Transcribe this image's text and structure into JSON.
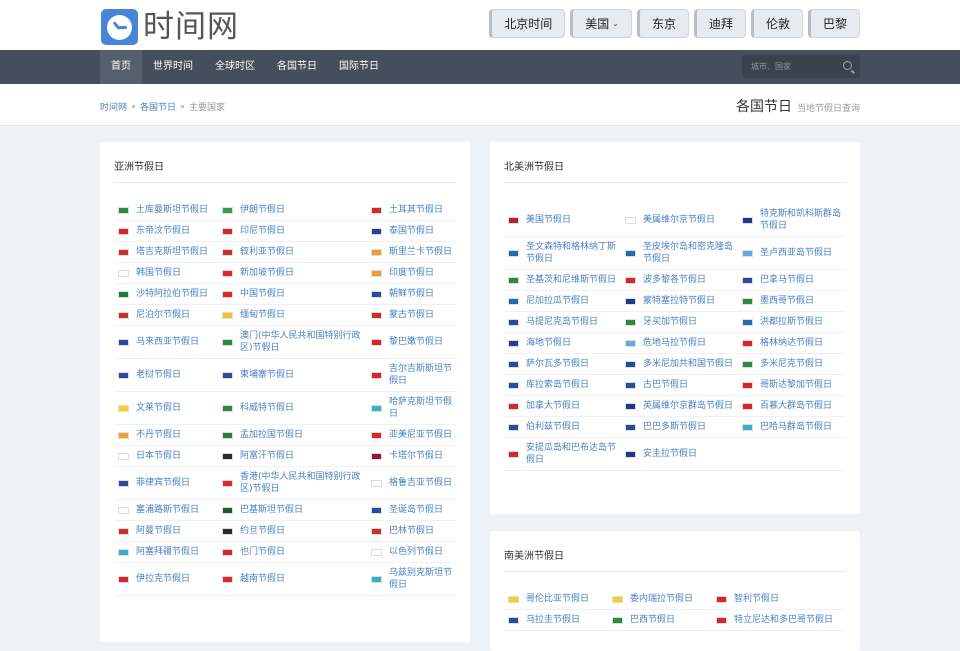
{
  "brand": {
    "logo_text": "时间网"
  },
  "cities": [
    "北京时间",
    "美国",
    "东京",
    "迪拜",
    "伦敦",
    "巴黎"
  ],
  "menu": [
    "首页",
    "世界时间",
    "全球时区",
    "各国节日",
    "国际节日"
  ],
  "search": {
    "placeholder": "城市、国家"
  },
  "breadcrumb": [
    "时间网",
    "各国节日",
    "主要国家"
  ],
  "page": {
    "title": "各国节日",
    "subtitle": "当地节假日查询"
  },
  "asia": {
    "title": "亚洲节假日",
    "rows": [
      [
        {
          "n": "土库曼斯坦节假日",
          "c": "#2b8a3e"
        },
        {
          "n": "伊朗节假日",
          "c": "#3a9a4a"
        },
        {
          "n": "土耳其节假日",
          "c": "#d7262b"
        }
      ],
      [
        {
          "n": "东帝汶节假日",
          "c": "#d6262b"
        },
        {
          "n": "印尼节假日",
          "c": "#d6262b"
        },
        {
          "n": "泰国节假日",
          "c": "#2c3e8f"
        }
      ],
      [
        {
          "n": "塔吉克斯坦节假日",
          "c": "#c9302c"
        },
        {
          "n": "叙利亚节假日",
          "c": "#c9302c"
        },
        {
          "n": "斯里兰卡节假日",
          "c": "#e3a127"
        }
      ],
      [
        {
          "n": "韩国节假日",
          "c": "#ffffff"
        },
        {
          "n": "新加坡节假日",
          "c": "#e2262b"
        },
        {
          "n": "印度节假日",
          "c": "#f29b38"
        }
      ],
      [
        {
          "n": "沙特阿拉伯节假日",
          "c": "#1f7a3a"
        },
        {
          "n": "中国节假日",
          "c": "#e2262b"
        },
        {
          "n": "朝鲜节假日",
          "c": "#2a4aa0"
        }
      ],
      [
        {
          "n": "尼泊尔节假日",
          "c": "#c9302c"
        },
        {
          "n": "缅甸节假日",
          "c": "#f4c02b"
        },
        {
          "n": "蒙古节假日",
          "c": "#c9302c"
        }
      ],
      [
        {
          "n": "马来西亚节假日",
          "c": "#2a4aa0"
        },
        {
          "n": "澳门(中华人民共和国特别行政区)节假日",
          "c": "#2b8a3e"
        },
        {
          "n": "黎巴嫩节假日",
          "c": "#d7262b"
        }
      ],
      [
        {
          "n": "老挝节假日",
          "c": "#2a4aa0"
        },
        {
          "n": "柬埔寨节假日",
          "c": "#2a4aa0"
        },
        {
          "n": "吉尔吉斯斯坦节假日",
          "c": "#d7262b"
        }
      ],
      [
        {
          "n": "文莱节假日",
          "c": "#f4d02b"
        },
        {
          "n": "科威特节假日",
          "c": "#2b8a3e"
        },
        {
          "n": "哈萨克斯坦节假日",
          "c": "#3ab0c8"
        }
      ],
      [
        {
          "n": "不丹节假日",
          "c": "#f29b38"
        },
        {
          "n": "孟加拉国节假日",
          "c": "#2b7a3e"
        },
        {
          "n": "亚美尼亚节假日",
          "c": "#d7262b"
        }
      ],
      [
        {
          "n": "日本节假日",
          "c": "#ffffff"
        },
        {
          "n": "阿富汗节假日",
          "c": "#2b2b2b"
        },
        {
          "n": "卡塔尔节假日",
          "c": "#8a1c3a"
        }
      ],
      [
        {
          "n": "菲律宾节假日",
          "c": "#2a4aa0"
        },
        {
          "n": "香港(中华人民共和国特别行政区)节假日",
          "c": "#e2262b"
        },
        {
          "n": "格鲁吉亚节假日",
          "c": "#ffffff"
        }
      ],
      [
        {
          "n": "塞浦路斯节假日",
          "c": "#ffffff"
        },
        {
          "n": "巴基斯坦节假日",
          "c": "#1f5a2a"
        },
        {
          "n": "圣诞岛节假日",
          "c": "#2a4aa0"
        }
      ],
      [
        {
          "n": "阿曼节假日",
          "c": "#c9302c"
        },
        {
          "n": "约旦节假日",
          "c": "#2b2b2b"
        },
        {
          "n": "巴林节假日",
          "c": "#c9302c"
        }
      ],
      [
        {
          "n": "阿塞拜疆节假日",
          "c": "#3ab0c8"
        },
        {
          "n": "也门节假日",
          "c": "#d7262b"
        },
        {
          "n": "以色列节假日",
          "c": "#ffffff"
        }
      ],
      [
        {
          "n": "伊拉克节假日",
          "c": "#d7262b"
        },
        {
          "n": "越南节假日",
          "c": "#e2262b"
        },
        {
          "n": "乌兹别克斯坦节假日",
          "c": "#3ab0c8"
        }
      ]
    ]
  },
  "north_america": {
    "title": "北美洲节假日",
    "rows": [
      [
        {
          "n": "美国节假日",
          "c": "#b22234"
        },
        {
          "n": "美属维尔京节假日",
          "c": "#ffffff"
        },
        {
          "n": "特克斯和凯科斯群岛节假日",
          "c": "#1f3a8a"
        }
      ],
      [
        {
          "n": "圣文森特和格林纳丁斯节假日",
          "c": "#2a6ab0"
        },
        {
          "n": "圣皮埃尔岛和密克隆岛节假日",
          "c": "#2a6ab0"
        },
        {
          "n": "圣卢西亚岛节假日",
          "c": "#66aadd"
        }
      ],
      [
        {
          "n": "圣基茨和尼维斯节假日",
          "c": "#2b8a3e"
        },
        {
          "n": "波多黎各节假日",
          "c": "#d7262b"
        },
        {
          "n": "巴拿马节假日",
          "c": "#2a4aa0"
        }
      ],
      [
        {
          "n": "尼加拉瓜节假日",
          "c": "#2a6ab0"
        },
        {
          "n": "蒙特塞拉特节假日",
          "c": "#1f3a8a"
        },
        {
          "n": "墨西哥节假日",
          "c": "#2b8a3e"
        }
      ],
      [
        {
          "n": "马提尼克岛节假日",
          "c": "#2a4aa0"
        },
        {
          "n": "牙买加节假日",
          "c": "#2b8a3e"
        },
        {
          "n": "洪都拉斯节假日",
          "c": "#2a6ab0"
        }
      ],
      [
        {
          "n": "海地节假日",
          "c": "#2a3a9a"
        },
        {
          "n": "危地马拉节假日",
          "c": "#66aadd"
        },
        {
          "n": "格林纳达节假日",
          "c": "#d7262b"
        }
      ],
      [
        {
          "n": "萨尔瓦多节假日",
          "c": "#2a4aa0"
        },
        {
          "n": "多米尼加共和国节假日",
          "c": "#2a4aa0"
        },
        {
          "n": "多米尼克节假日",
          "c": "#2b8a3e"
        }
      ],
      [
        {
          "n": "库拉索岛节假日",
          "c": "#2a4aa0"
        },
        {
          "n": "古巴节假日",
          "c": "#2a4aa0"
        },
        {
          "n": "哥斯达黎加节假日",
          "c": "#d7262b"
        }
      ],
      [
        {
          "n": "加拿大节假日",
          "c": "#d7262b"
        },
        {
          "n": "英属维尔京群岛节假日",
          "c": "#1f3a8a"
        },
        {
          "n": "百慕大群岛节假日",
          "c": "#d7262b"
        }
      ],
      [
        {
          "n": "伯利兹节假日",
          "c": "#2a4aa0"
        },
        {
          "n": "巴巴多斯节假日",
          "c": "#2a4aa0"
        },
        {
          "n": "巴哈马群岛节假日",
          "c": "#3ab0c8"
        }
      ],
      [
        {
          "n": "安提瓜岛和巴布达岛节假日",
          "c": "#d7262b"
        },
        {
          "n": "安圭拉节假日",
          "c": "#1f3a8a"
        },
        {
          "n": "",
          "c": ""
        }
      ]
    ]
  },
  "south_america": {
    "title": "南美洲节假日",
    "rows": [
      [
        {
          "n": "哥伦比亚节假日",
          "c": "#f4d02b"
        },
        {
          "n": "委内瑞拉节假日",
          "c": "#f4d02b"
        },
        {
          "n": "智利节假日",
          "c": "#d7262b"
        }
      ],
      [
        {
          "n": "乌拉圭节假日",
          "c": "#2a4aa0"
        },
        {
          "n": "巴西节假日",
          "c": "#2b8a3e"
        },
        {
          "n": "特立尼达和多巴哥节假日",
          "c": "#d7262b"
        }
      ]
    ]
  }
}
